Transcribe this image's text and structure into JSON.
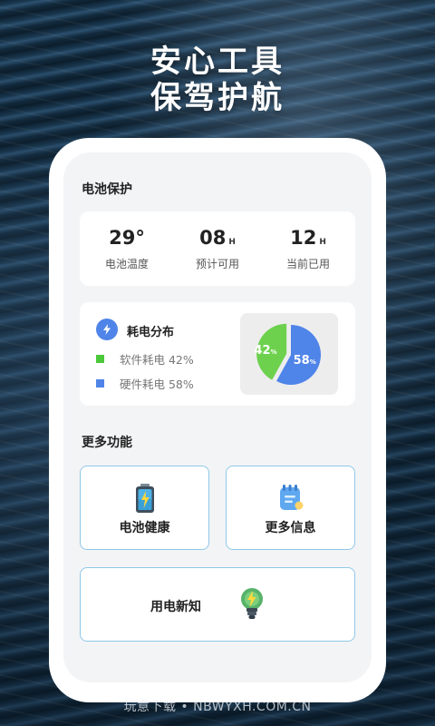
{
  "hero": {
    "line1": "安心工具",
    "line2": "保驾护航"
  },
  "battery_protection": {
    "title": "电池保护",
    "stats": [
      {
        "value": "29°",
        "unit": "",
        "label": "电池温度"
      },
      {
        "value": "08",
        "unit": "H",
        "label": "预计可用"
      },
      {
        "value": "12",
        "unit": "H",
        "label": "当前已用"
      }
    ]
  },
  "distribution": {
    "title": "耗电分布",
    "legend": [
      {
        "label": "软件耗电 42%",
        "color": "#4cc93a"
      },
      {
        "label": "硬件耗电 58%",
        "color": "#4f84e8"
      }
    ],
    "pie": [
      {
        "name": "软件耗电",
        "value": 42,
        "label": "42",
        "color": "#6dd14e"
      },
      {
        "name": "硬件耗电",
        "value": 58,
        "label": "58",
        "color": "#4f84e8"
      }
    ],
    "pie_unit": "%"
  },
  "more": {
    "title": "更多功能",
    "items": [
      {
        "label": "电池健康",
        "icon": "battery-icon"
      },
      {
        "label": "更多信息",
        "icon": "notepad-icon"
      },
      {
        "label": "用电新知",
        "icon": "lightbulb-icon"
      }
    ]
  },
  "watermark": "玩意下载 • NBWYXH.COM.CN"
}
